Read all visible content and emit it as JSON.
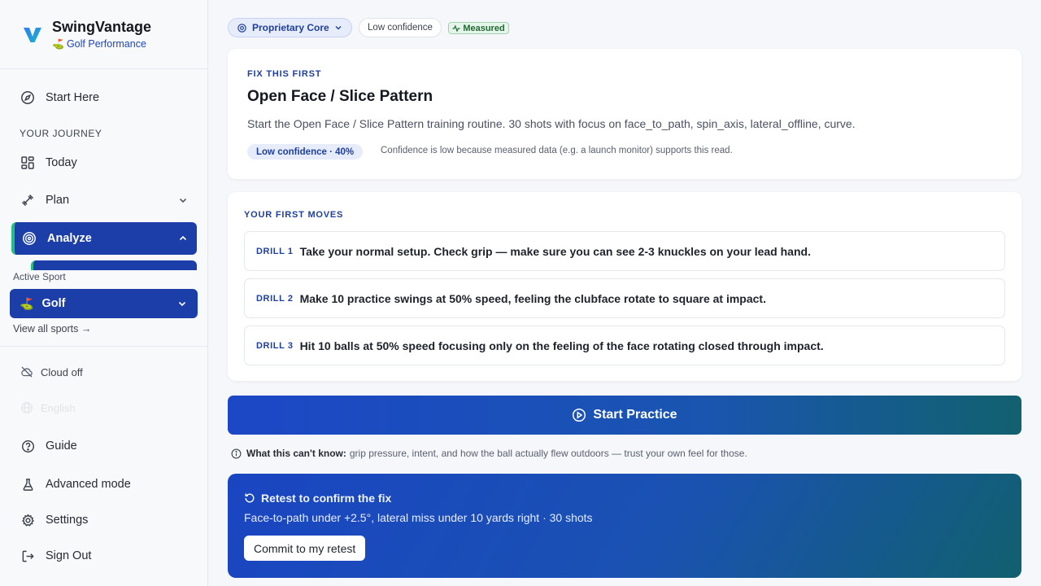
{
  "brand": {
    "name": "SwingVantage",
    "subtitle_emoji": "⛳",
    "subtitle": "Golf Performance",
    "accent": "#1e46b4"
  },
  "sidebar": {
    "start_here": "Start Here",
    "section_label": "YOUR JOURNEY",
    "items": [
      {
        "label": "Today",
        "icon": "grid-icon"
      },
      {
        "label": "Plan",
        "icon": "dumbbell-icon",
        "expandable": true
      },
      {
        "label": "Analyze",
        "icon": "target-icon",
        "expandable": true,
        "active": true
      }
    ],
    "active_sport_label": "Active Sport",
    "active_sport_emoji": "⛳",
    "active_sport": "Golf",
    "view_all": "View all sports →",
    "cloud_status": "Cloud off",
    "language": "English",
    "bottom": [
      {
        "label": "Guide",
        "icon": "help-circle-icon"
      },
      {
        "label": "Advanced mode",
        "icon": "flask-icon"
      },
      {
        "label": "Settings",
        "icon": "gear-icon"
      },
      {
        "label": "Sign Out",
        "icon": "sign-out-icon"
      }
    ],
    "active_color": "#1b3ea8",
    "active_marker_color": "#22c07a"
  },
  "chips": {
    "core": "Proprietary Core",
    "confidence": "Low confidence",
    "measured": "Measured"
  },
  "fix": {
    "eyebrow": "FIX THIS FIRST",
    "title": "Open Face / Slice Pattern",
    "description": "Start the Open Face / Slice Pattern training routine. 30 shots with focus on face_to_path, spin_axis, lateral_offline, curve.",
    "confidence_badge": "Low confidence · 40%",
    "confidence_note": "Confidence is low because measured data (e.g. a launch monitor) supports this read."
  },
  "moves": {
    "eyebrow": "YOUR FIRST MOVES",
    "drills": [
      {
        "tag": "DRILL 1",
        "text": "Take your normal setup. Check grip — make sure you can see 2-3 knuckles on your lead hand."
      },
      {
        "tag": "DRILL 2",
        "text": "Make 10 practice swings at 50% speed, feeling the clubface rotate to square at impact."
      },
      {
        "tag": "DRILL 3",
        "text": "Hit 10 balls at 50% speed focusing only on the feeling of the face rotating closed through impact."
      }
    ]
  },
  "start_practice": "Start Practice",
  "limits": {
    "label": "What this can't know:",
    "text": "grip pressure, intent, and how the ball actually flew outdoors — trust your own feel for those."
  },
  "retest": {
    "title": "Retest to confirm the fix",
    "description": "Face-to-path under +2.5°, lateral miss under 10 yards right · 30 shots",
    "button": "Commit to my retest"
  }
}
